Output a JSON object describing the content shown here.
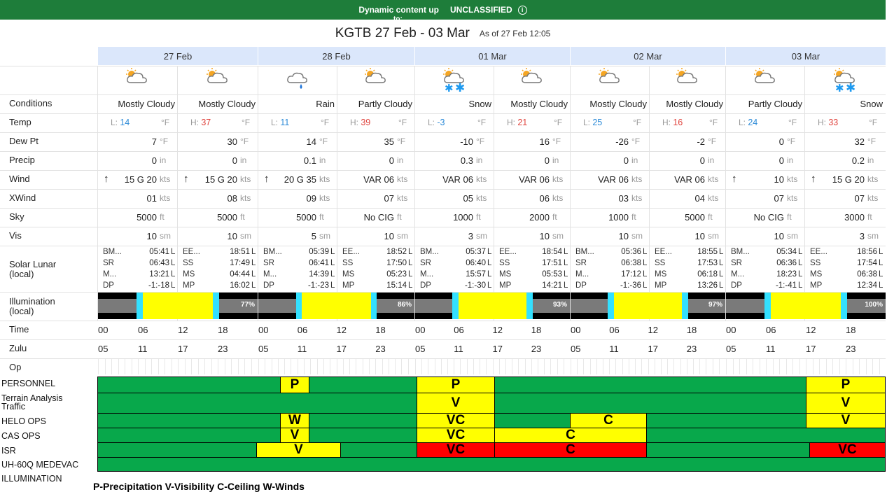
{
  "banner": {
    "text": "Dynamic content up",
    "overflow": "to:",
    "classification": "UNCLASSIFIED",
    "info_icon": "info-circle-icon"
  },
  "header": {
    "title": "KGTB 27 Feb - 03 Mar",
    "as_of": "As of 27 Feb 12:05"
  },
  "days": [
    "27 Feb",
    "28 Feb",
    "01 Mar",
    "02 Mar",
    "03 Mar"
  ],
  "row_labels": {
    "conditions": "Conditions",
    "temp": "Temp",
    "dewpt": "Dew Pt",
    "precip": "Precip",
    "wind": "Wind",
    "xwind": "XWind",
    "sky": "Sky",
    "vis": "Vis",
    "solar": "Solar Lunar\n(local)",
    "illum": "Illumination\n(local)",
    "time": "Time",
    "zulu": "Zulu",
    "op": "Op"
  },
  "units": {
    "temp": "°F",
    "precip": "in",
    "wind": "kts",
    "sky": "ft",
    "vis": "sm",
    "L": "L"
  },
  "periods": [
    {
      "icon": "partly-cloudy-sun-icon",
      "cond": "Mostly Cloudy",
      "temp_prefix": "L:",
      "temp": "14",
      "temp_kind": "low",
      "dewpt": "7",
      "precip": "0",
      "wind": "15 G 20",
      "wind_arrow": true,
      "xwind": "01",
      "sky": "5000",
      "vis": "10"
    },
    {
      "icon": "partly-cloudy-sun-icon",
      "cond": "Mostly Cloudy",
      "temp_prefix": "H:",
      "temp": "37",
      "temp_kind": "high",
      "dewpt": "30",
      "precip": "0",
      "wind": "15 G 20",
      "wind_arrow": true,
      "xwind": "08",
      "sky": "5000",
      "vis": "10"
    },
    {
      "icon": "rain-cloud-icon",
      "cond": "Rain",
      "temp_prefix": "L:",
      "temp": "11",
      "temp_kind": "low",
      "dewpt": "14",
      "precip": "0.1",
      "wind": "20 G 35",
      "wind_arrow": true,
      "xwind": "09",
      "sky": "5000",
      "vis": "5"
    },
    {
      "icon": "partly-cloudy-sun-icon",
      "cond": "Partly Cloudy",
      "temp_prefix": "H:",
      "temp": "39",
      "temp_kind": "high",
      "dewpt": "35",
      "precip": "0",
      "wind": "VAR 06",
      "wind_arrow": false,
      "xwind": "07",
      "sky": "No CIG",
      "vis": "10"
    },
    {
      "icon": "snow-cloud-icon",
      "cond": "Snow",
      "temp_prefix": "L:",
      "temp": "-3",
      "temp_kind": "low",
      "dewpt": "-10",
      "precip": "0.3",
      "wind": "VAR 06",
      "wind_arrow": false,
      "xwind": "05",
      "sky": "1000",
      "vis": "3"
    },
    {
      "icon": "partly-cloudy-sun-icon",
      "cond": "Mostly Cloudy",
      "temp_prefix": "H:",
      "temp": "21",
      "temp_kind": "high",
      "dewpt": "16",
      "precip": "0",
      "wind": "VAR 06",
      "wind_arrow": false,
      "xwind": "06",
      "sky": "2000",
      "vis": "10"
    },
    {
      "icon": "partly-cloudy-sun-icon",
      "cond": "Mostly Cloudy",
      "temp_prefix": "L:",
      "temp": "25",
      "temp_kind": "low",
      "dewpt": "-26",
      "precip": "0",
      "wind": "VAR 06",
      "wind_arrow": false,
      "xwind": "03",
      "sky": "1000",
      "vis": "10"
    },
    {
      "icon": "partly-cloudy-sun-icon",
      "cond": "Mostly Cloudy",
      "temp_prefix": "H:",
      "temp": "16",
      "temp_kind": "high",
      "dewpt": "-2",
      "precip": "0",
      "wind": "VAR 06",
      "wind_arrow": false,
      "xwind": "04",
      "sky": "5000",
      "vis": "10"
    },
    {
      "icon": "partly-cloudy-sun-icon",
      "cond": "Partly Cloudy",
      "temp_prefix": "L:",
      "temp": "24",
      "temp_kind": "low",
      "dewpt": "0",
      "precip": "0",
      "wind": "10",
      "wind_arrow": true,
      "xwind": "07",
      "sky": "No CIG",
      "vis": "10"
    },
    {
      "icon": "snow-cloud-icon",
      "cond": "Snow",
      "temp_prefix": "H:",
      "temp": "33",
      "temp_kind": "high",
      "dewpt": "32",
      "precip": "0.2",
      "wind": "15 G 20",
      "wind_arrow": true,
      "xwind": "07",
      "sky": "3000",
      "vis": "3"
    }
  ],
  "solar": [
    [
      [
        "BM...",
        "05:41"
      ],
      [
        "SR",
        "06:43"
      ],
      [
        "M...",
        "13:21"
      ],
      [
        "DP",
        "-1:-18"
      ]
    ],
    [
      [
        "EE...",
        "18:51"
      ],
      [
        "SS",
        "17:49"
      ],
      [
        "MS",
        "04:44"
      ],
      [
        "MP",
        "16:02"
      ]
    ],
    [
      [
        "BM...",
        "05:39"
      ],
      [
        "SR",
        "06:41"
      ],
      [
        "M...",
        "14:39"
      ],
      [
        "DP",
        "-1:-23"
      ]
    ],
    [
      [
        "EE...",
        "18:52"
      ],
      [
        "SS",
        "17:50"
      ],
      [
        "MS",
        "05:23"
      ],
      [
        "MP",
        "15:14"
      ]
    ],
    [
      [
        "BM...",
        "05:37"
      ],
      [
        "SR",
        "06:40"
      ],
      [
        "M...",
        "15:57"
      ],
      [
        "DP",
        "-1:-30"
      ]
    ],
    [
      [
        "EE...",
        "18:54"
      ],
      [
        "SS",
        "17:51"
      ],
      [
        "MS",
        "05:53"
      ],
      [
        "MP",
        "14:21"
      ]
    ],
    [
      [
        "BM...",
        "05:36"
      ],
      [
        "SR",
        "06:38"
      ],
      [
        "M...",
        "17:12"
      ],
      [
        "DP",
        "-1:-36"
      ]
    ],
    [
      [
        "EE...",
        "18:55"
      ],
      [
        "SS",
        "17:53"
      ],
      [
        "MS",
        "06:18"
      ],
      [
        "MP",
        "13:26"
      ]
    ],
    [
      [
        "BM...",
        "05:34"
      ],
      [
        "SR",
        "06:36"
      ],
      [
        "M...",
        "18:23"
      ],
      [
        "DP",
        "-1:-41"
      ]
    ],
    [
      [
        "EE...",
        "18:56"
      ],
      [
        "SS",
        "17:54"
      ],
      [
        "MS",
        "06:38"
      ],
      [
        "MP",
        "12:34"
      ]
    ]
  ],
  "illumination": [
    "77%",
    "86%",
    "93%",
    "97%",
    "100%"
  ],
  "time_ticks": [
    "00",
    "06",
    "12",
    "18"
  ],
  "zulu_ticks": [
    "05",
    "11",
    "17",
    "23"
  ],
  "ops": {
    "labels": [
      "PERSONNEL",
      "Terrain Analysis\nTraffic",
      "HELO OPS",
      "CAS OPS",
      "ISR",
      "UH-60Q MEDEVAC",
      "ILLUMINATION"
    ],
    "letters": {
      "personnel": [
        "P",
        "P",
        "P"
      ],
      "terrain": [
        "V",
        "V"
      ],
      "helo": [
        "W",
        "VC",
        "C",
        "V"
      ],
      "cas": [
        "V",
        "VC",
        "C"
      ],
      "isr": [
        "V",
        "VC",
        "C",
        "VC"
      ]
    },
    "colors": {
      "green": "#08a84b",
      "yellow": "#ffff00",
      "red": "#ff0000"
    }
  },
  "legend": "P-Precipitation V-Visibility C-Ceiling W-Winds"
}
